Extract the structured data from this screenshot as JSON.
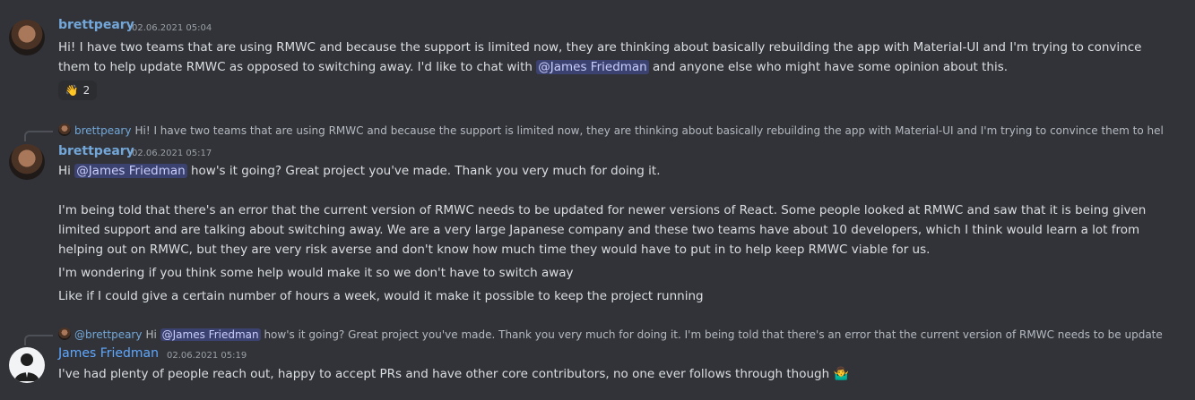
{
  "messages": [
    {
      "username": "brettpeary",
      "timestamp": "02.06.2021 05:04",
      "text_before": "Hi! I have two teams that are using RMWC and because the support is limited now, they are thinking about basically rebuilding the app with Material-UI and I'm trying to convince them to help update RMWC as opposed to switching away. I'd like to chat with ",
      "mention": "@James Friedman",
      "text_after": " and anyone else who might have some opinion about this.",
      "reaction": {
        "emoji": "👋",
        "count": "2"
      }
    },
    {
      "reply": {
        "username": "brettpeary",
        "text": "Hi! I have two teams that are using RMWC and because the support is limited now, they are thinking about basically rebuilding the app with Material-UI and I'm trying to convince them to help up"
      },
      "username": "brettpeary",
      "timestamp": "02.06.2021 05:17",
      "line1_prefix": "Hi ",
      "mention": "@James Friedman",
      "line1_suffix": " how's it going? Great project you've made. Thank you very much for doing it.",
      "paragraph": "I'm being told that there's an error that the current version of RMWC needs to be updated for newer versions of React. Some people looked at RMWC and saw that it is being given limited support and are talking about switching away. We are a very large Japanese company and these two teams have about 10 developers, which I think would learn a lot from helping out on RMWC, but they are very risk averse and don't know how much time they would have to put in to help keep RMWC viable for us.",
      "line3": "I'm wondering if you think some help would make it so we don't have to switch away",
      "line4": "Like if I could give a certain number of hours a week, would it make it possible to keep the project running"
    },
    {
      "reply": {
        "username": "@brettpeary",
        "text_before": "Hi ",
        "mention": "@James Friedman",
        "text_after": " how's it going? Great project you've made. Thank you very much for doing it. I'm being told that there's an error that the current version of RMWC needs to be updated fo"
      },
      "username": "James Friedman",
      "timestamp": "02.06.2021 05:19",
      "text": "I've had plenty of people reach out, happy to accept PRs and have other core contributors, no one ever follows through though",
      "emoji": "🤷‍♂️"
    }
  ]
}
